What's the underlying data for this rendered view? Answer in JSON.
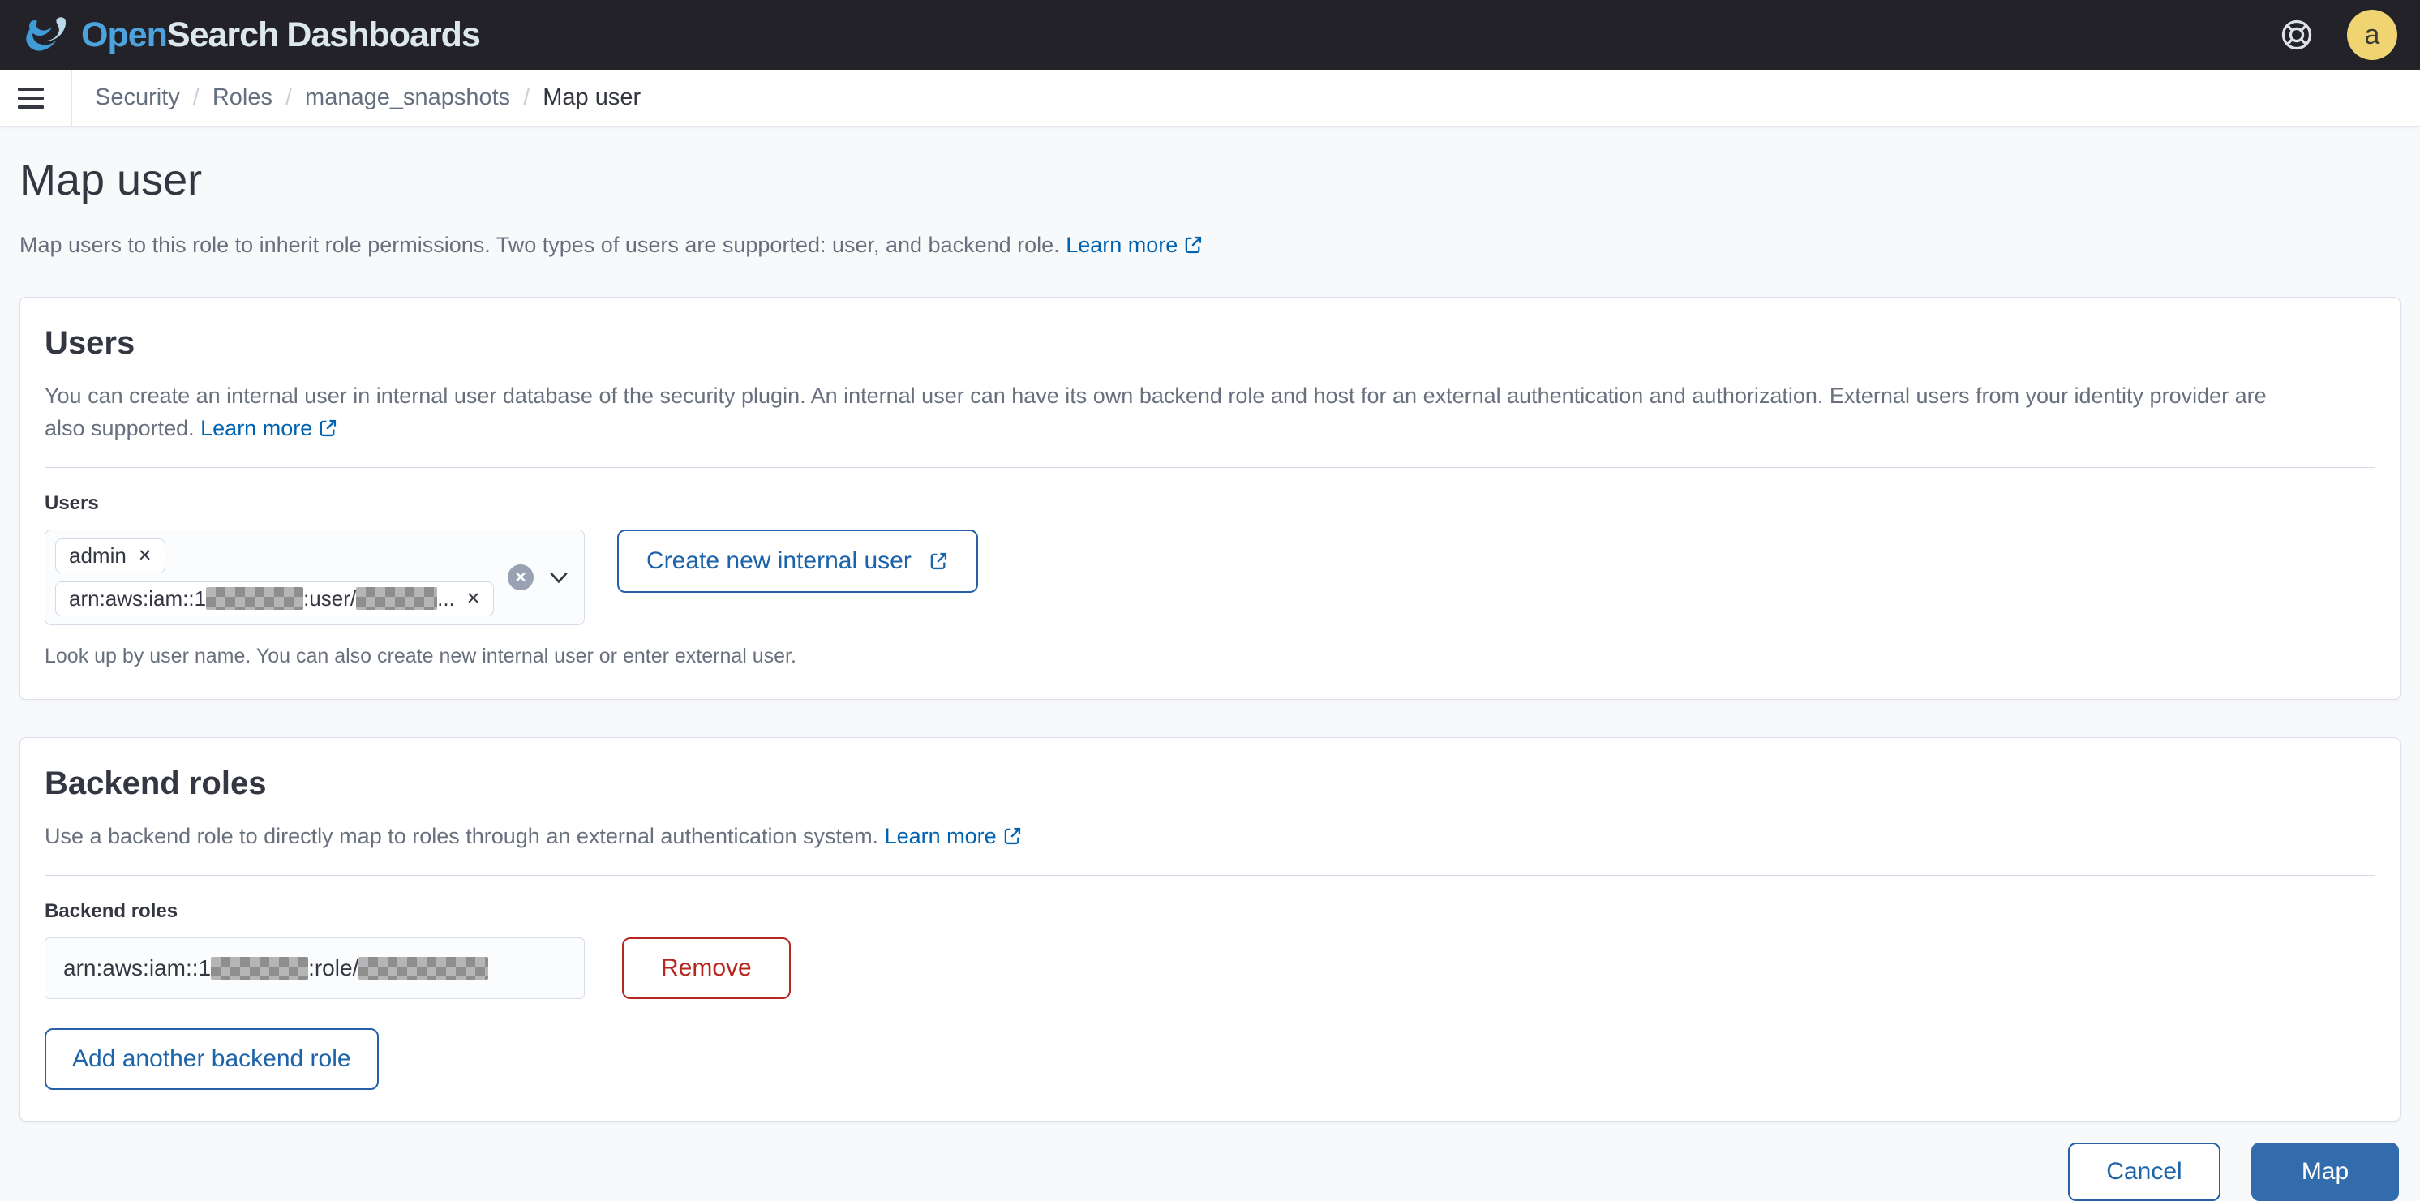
{
  "header": {
    "logo_open": "Open",
    "logo_search": "Search",
    "logo_dashboards": "Dashboards",
    "avatar_letter": "a"
  },
  "breadcrumbs": {
    "items": [
      {
        "label": "Security"
      },
      {
        "label": "Roles"
      },
      {
        "label": "manage_snapshots"
      }
    ],
    "separator": "/",
    "current": "Map user"
  },
  "page": {
    "title": "Map user",
    "description": "Map users to this role to inherit role permissions. Two types of users are supported: user, and backend role.",
    "learn_more": "Learn more"
  },
  "users_panel": {
    "title": "Users",
    "description_line1": "You can create an internal user in internal user database of the security plugin. An internal user can have its own backend role and host for an external authentication and authorization. External users from your identity provider are",
    "description_line2": "also supported.",
    "learn_more": "Learn more",
    "field_label": "Users",
    "pill_admin": "admin",
    "pill_arn_prefix": "arn:aws:iam::1",
    "pill_arn_mid": ":user/",
    "pill_arn_ellipsis": "...",
    "remove_pill_symbol": "✕",
    "clear_symbol": "✕",
    "create_button": "Create new internal user",
    "help_text": "Look up by user name. You can also create new internal user or enter external user."
  },
  "backend_panel": {
    "title": "Backend roles",
    "description": "Use a backend role to directly map to roles through an external authentication system.",
    "learn_more": "Learn more",
    "field_label": "Backend roles",
    "field_prefix": "arn:aws:iam::1",
    "field_mid": ":role/",
    "remove_button": "Remove",
    "add_button": "Add another backend role"
  },
  "footer": {
    "cancel_button": "Cancel",
    "map_button": "Map"
  },
  "colors": {
    "header_bg": "#222228",
    "link_blue": "#0063b1",
    "button_blue": "#1c63a9",
    "map_fill": "#326cac",
    "danger_red": "#b6271e",
    "avatar_bg": "#f1d472",
    "panel_border": "#d3dae6"
  }
}
